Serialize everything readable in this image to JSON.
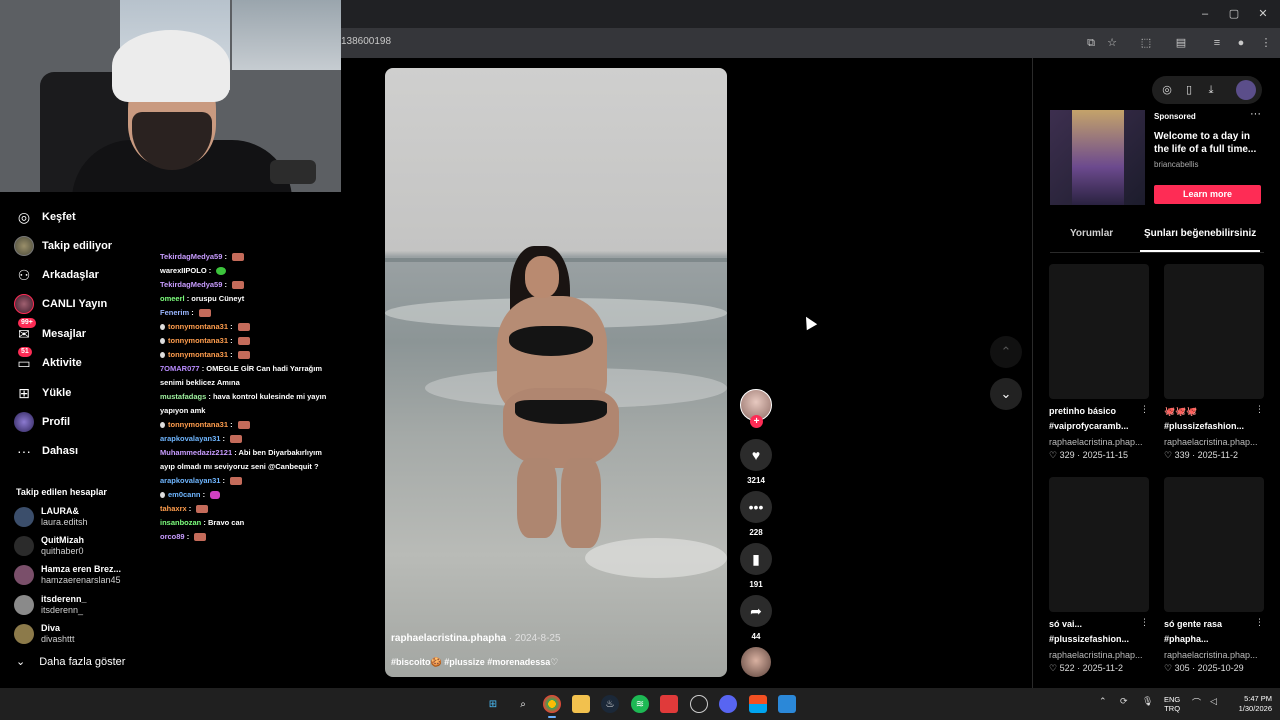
{
  "browser": {
    "url_fragment": "138600198",
    "window_controls": [
      "–",
      "▢",
      "✕"
    ]
  },
  "sidebar": {
    "items": [
      {
        "label": "Keşfet",
        "icon": "compass-icon"
      },
      {
        "label": "Takip ediliyor",
        "icon": "avatar-icon"
      },
      {
        "label": "Arkadaşlar",
        "icon": "friends-icon"
      },
      {
        "label": "CANLI Yayın",
        "icon": "live-icon"
      },
      {
        "label": "Mesajlar",
        "icon": "messages-icon",
        "badge": "99+"
      },
      {
        "label": "Aktivite",
        "icon": "activity-icon",
        "badge": "51"
      },
      {
        "label": "Yükle",
        "icon": "upload-icon"
      },
      {
        "label": "Profil",
        "icon": "profile-icon"
      },
      {
        "label": "Dahası",
        "icon": "more-dots-icon"
      }
    ],
    "following_heading": "Takip edilen hesaplar",
    "following": [
      {
        "name": "LAURA&",
        "handle": "laura.editsh",
        "color": "#3b4e6b"
      },
      {
        "name": "QuitMizah",
        "handle": "quithaber0",
        "color": "#2b2b2b"
      },
      {
        "name": "Hamza eren Brez...",
        "handle": "hamzaerenarslan45",
        "color": "#7a4f6a"
      },
      {
        "name": "itsderenn_",
        "handle": "itsderenn_",
        "color": "#8a8a8a"
      },
      {
        "name": "Diva",
        "handle": "divashttt",
        "color": "#8c7a4a"
      }
    ],
    "show_more": "Daha fazla göster"
  },
  "chat": [
    {
      "user": "TekirdagMedya59",
      "color": "#c89cff",
      "text": "",
      "emote": "red"
    },
    {
      "user": "warexIIPOLO",
      "color": "#ffffff",
      "text": "",
      "emote": "green"
    },
    {
      "user": "TekirdagMedya59",
      "color": "#c89cff",
      "text": "",
      "emote": "red"
    },
    {
      "user": "omeerl",
      "color": "#7dff7d",
      "text": "oruspu Cüneyt",
      "emote": ""
    },
    {
      "user": "Fenerim",
      "color": "#9ab6ff",
      "text": "",
      "emote": "red"
    },
    {
      "user": "tonnymontana31",
      "color": "#ff9d4d",
      "text": "",
      "emote": "red",
      "drop": true
    },
    {
      "user": "tonnymontana31",
      "color": "#ff9d4d",
      "text": "",
      "emote": "red",
      "drop": true
    },
    {
      "user": "tonnymontana31",
      "color": "#ff9d4d",
      "text": "",
      "emote": "red",
      "drop": true
    },
    {
      "user": "7OMAR077",
      "color": "#b98cff",
      "text": "OMEGLE GİR Can hadi Yarrağım",
      "emote": ""
    },
    {
      "user": "",
      "color": "#ffffff",
      "text": "senimi beklicez Amına",
      "emote": ""
    },
    {
      "user": "mustafadags",
      "color": "#9ef09e",
      "text": "hava kontrol kulesinde mi yayın",
      "emote": ""
    },
    {
      "user": "",
      "color": "#ffffff",
      "text": "yapıyon amk",
      "emote": ""
    },
    {
      "user": "tonnymontana31",
      "color": "#ff9d4d",
      "text": "",
      "emote": "red",
      "drop": true
    },
    {
      "user": "arapkovalayan31",
      "color": "#6fb6ff",
      "text": "",
      "emote": "red"
    },
    {
      "user": "Muhammedaziz2121",
      "color": "#c89cff",
      "text": "Abi ben Diyarbakırlıyım",
      "emote": ""
    },
    {
      "user": "",
      "color": "#ffffff",
      "text": "ayıp olmadı mı seviyoruz seni @Canbequit ?",
      "emote": ""
    },
    {
      "user": "arapkovalayan31",
      "color": "#6fb6ff",
      "text": "",
      "emote": "red"
    },
    {
      "user": "em0cann",
      "color": "#6fb6ff",
      "text": "",
      "emote": "pink",
      "drop": true
    },
    {
      "user": "tahaxrx",
      "color": "#ff9d4d",
      "text": "",
      "emote": "red"
    },
    {
      "user": "insanbozan",
      "color": "#7dff7d",
      "text": "Bravo can",
      "emote": ""
    },
    {
      "user": "orco89",
      "color": "#c89cff",
      "text": "",
      "emote": "red"
    }
  ],
  "video": {
    "author": "raphaelacristina.phapha",
    "date": "· 2024-8-25",
    "tags": "#biscoito🍪 #plussize #morenadessa♡"
  },
  "actions": {
    "likes": "3214",
    "comments": "228",
    "saves": "191",
    "shares": "44"
  },
  "ad": {
    "sponsored": "Sponsored",
    "title": "Welcome to a day in the life of a full time...",
    "handle": "briancabellis",
    "cta": "Learn more"
  },
  "tabs": [
    "Yorumlar",
    "Şunları beğenebilirsiniz"
  ],
  "recommendations": [
    {
      "title": "pretinho básico",
      "hashtag": "#vaiprofycaramb...",
      "author": "raphaelacristina.phap...",
      "likes": "329",
      "date": "2025-11-15"
    },
    {
      "title": "🐙🐙🐙",
      "hashtag": "#plussizefashion...",
      "author": "raphaelacristina.phap...",
      "likes": "339",
      "date": "2025-11-2"
    },
    {
      "title": "só vai...",
      "hashtag": "#plussizefashion...",
      "author": "raphaelacristina.phap...",
      "likes": "522",
      "date": "2025-11-2"
    },
    {
      "title": "só gente rasa",
      "hashtag": "#phapha...",
      "author": "raphaelacristina.phap...",
      "likes": "305",
      "date": "2025-10-29"
    }
  ],
  "taskbar": {
    "lang_line1": "ENG",
    "lang_line2": "TRQ",
    "time": "5:47 PM",
    "date": "1/30/2026"
  },
  "colors": {
    "accent": "#fe2c55",
    "background": "#000000"
  }
}
